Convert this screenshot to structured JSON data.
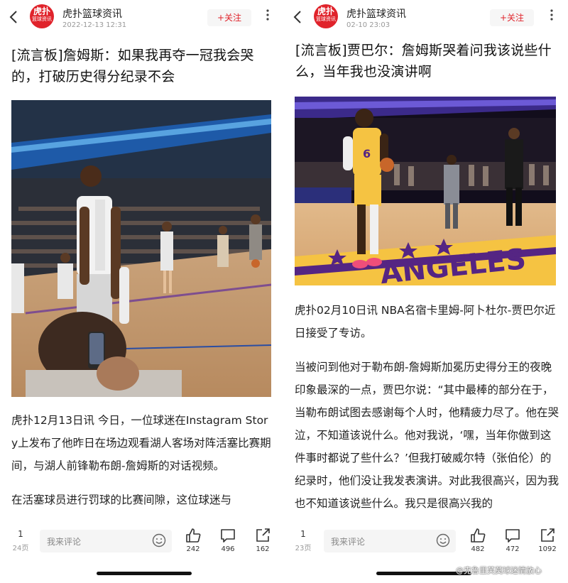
{
  "left": {
    "author": "虎扑篮球资讯",
    "date": "2022-12-13 12:31",
    "follow_label": "+关注",
    "title": "[流言板]詹姆斯：如果我再夺一冠我会哭的，打破历史得分纪录不会",
    "body": [
      "虎扑12月13日讯 今日，一位球迷在Instagram Story上发布了他昨日在场边观看湖人客场对阵活塞比赛期间，与湖人前锋勒布朗-詹姆斯的对话视频。",
      "在活塞球员进行罚球的比赛间隙，这位球迷与"
    ],
    "bottom": {
      "page_current": "1",
      "page_total": "24页",
      "comment_placeholder": "我来评论",
      "likes": "242",
      "comments": "496",
      "shares": "162"
    }
  },
  "right": {
    "author": "虎扑篮球资讯",
    "date": "02-10 23:03",
    "follow_label": "+关注",
    "title": "[流言板]贾巴尔：詹姆斯哭着问我该说些什么，当年我也没演讲啊",
    "body": [
      "虎扑02月10日讯 NBA名宿卡里姆-阿卜杜尔-贾巴尔近日接受了专访。",
      "当被问到他对于勒布朗-詹姆斯加冕历史得分王的夜晚印象最深的一点，贾巴尔说：“其中最棒的部分在于，当勒布朗试图去感谢每个人时，他精疲力尽了。他在哭泣，不知道该说什么。他对我说，‘嘿，当年你做到这件事时都说了些什么？’但我打破威尔特（张伯伦）的纪录时，他们没让我发表演讲。对此我很高兴，因为我也不知道该说些什么。我只是很高兴我的"
    ],
    "bottom": {
      "page_current": "1",
      "page_total": "23页",
      "comment_placeholder": "我来评论",
      "likes": "482",
      "comments": "472",
      "shares": "1092"
    },
    "jersey_number": "6",
    "court_text": "ANGELES"
  },
  "logo_text": "虎扑",
  "logo_subtext": "篮球资讯",
  "watermark": "@克鲁里芙莫球迷情放心",
  "colors": {
    "brand_red": "#e0232b",
    "laker_gold": "#f5c342",
    "laker_purple": "#552583"
  }
}
